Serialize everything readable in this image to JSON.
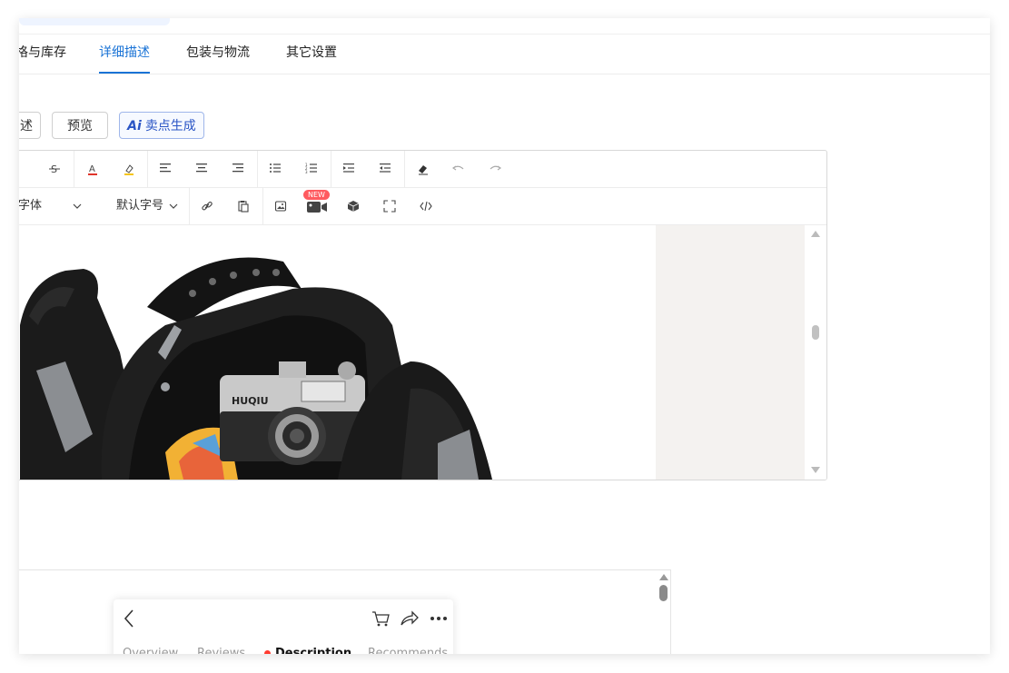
{
  "tabs": [
    {
      "label": "格与库存"
    },
    {
      "label": "详细描述"
    },
    {
      "label": "包装与物流"
    },
    {
      "label": "其它设置"
    }
  ],
  "active_tab": "详细描述",
  "buttons": {
    "partial_left": "述",
    "preview": "预览",
    "ai_icon": "Ai",
    "ai_generate": "卖点生成"
  },
  "toolbar": {
    "row1": [
      "strikethrough-icon",
      "font-color-icon",
      "highlight-icon",
      "align-left-icon",
      "align-center-icon",
      "align-right-icon",
      "bullet-list-icon",
      "numbered-list-icon",
      "indent-icon",
      "outdent-icon",
      "eraser-icon",
      "undo-icon",
      "redo-icon"
    ],
    "font_family": "字体",
    "font_size": "默认字号",
    "row2": [
      "link-icon",
      "paste-icon",
      "image-icon",
      "video-icon",
      "3d-model-icon",
      "fullscreen-icon",
      "code-view-icon"
    ],
    "new_badge": "NEW"
  },
  "editor_image": {
    "camera_brand": "HUQIU"
  },
  "mobile_preview": {
    "tabs": [
      "Overview",
      "Reviews",
      "Description",
      "Recommends"
    ],
    "active_tab": "Description"
  },
  "colors": {
    "accent": "#1a73d6",
    "new_badge": "#ff5a5f",
    "ai_button_text": "#2a55c5",
    "font_color_underline": "#e0352b",
    "highlight_underline": "#f5c518"
  }
}
